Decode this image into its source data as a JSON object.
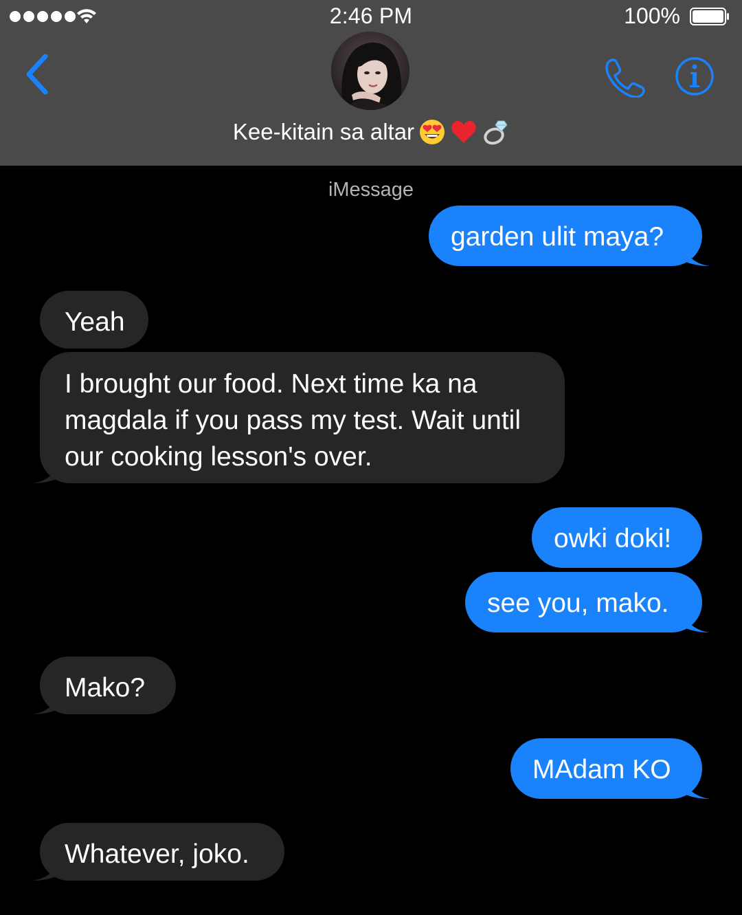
{
  "status_bar": {
    "time": "2:46 PM",
    "battery_percent": "100%",
    "signal_bars": 5,
    "battery_level": 1.0
  },
  "header": {
    "contact_name": "Kee-kitain sa altar",
    "name_emojis": [
      "smiling-face-with-heart-eyes-icon",
      "red-heart-icon",
      "ring-icon"
    ],
    "back_icon": "chevron-left-icon",
    "call_icon": "phone-icon",
    "info_icon": "info-icon"
  },
  "conversation": {
    "service_label": "iMessage",
    "messages": [
      {
        "direction": "sent",
        "text": "garden ulit maya?"
      },
      {
        "direction": "received",
        "text": "Yeah"
      },
      {
        "direction": "received",
        "text": "I brought our food. Next time ka na magdala if you pass my test. Wait until our cooking lesson's over."
      },
      {
        "direction": "sent",
        "text": "owki doki!"
      },
      {
        "direction": "sent",
        "text": "see you, mako."
      },
      {
        "direction": "received",
        "text": "Mako?"
      },
      {
        "direction": "sent",
        "text": "MAdam KO"
      },
      {
        "direction": "received",
        "text": "Whatever, joko."
      }
    ]
  },
  "colors": {
    "header_background": "#4a4a4a",
    "chat_background": "#000000",
    "sent_bubble": "#1a82fb",
    "received_bubble": "#262629",
    "accent_blue": "#1a82fb",
    "service_label": "#b4b4b8"
  }
}
